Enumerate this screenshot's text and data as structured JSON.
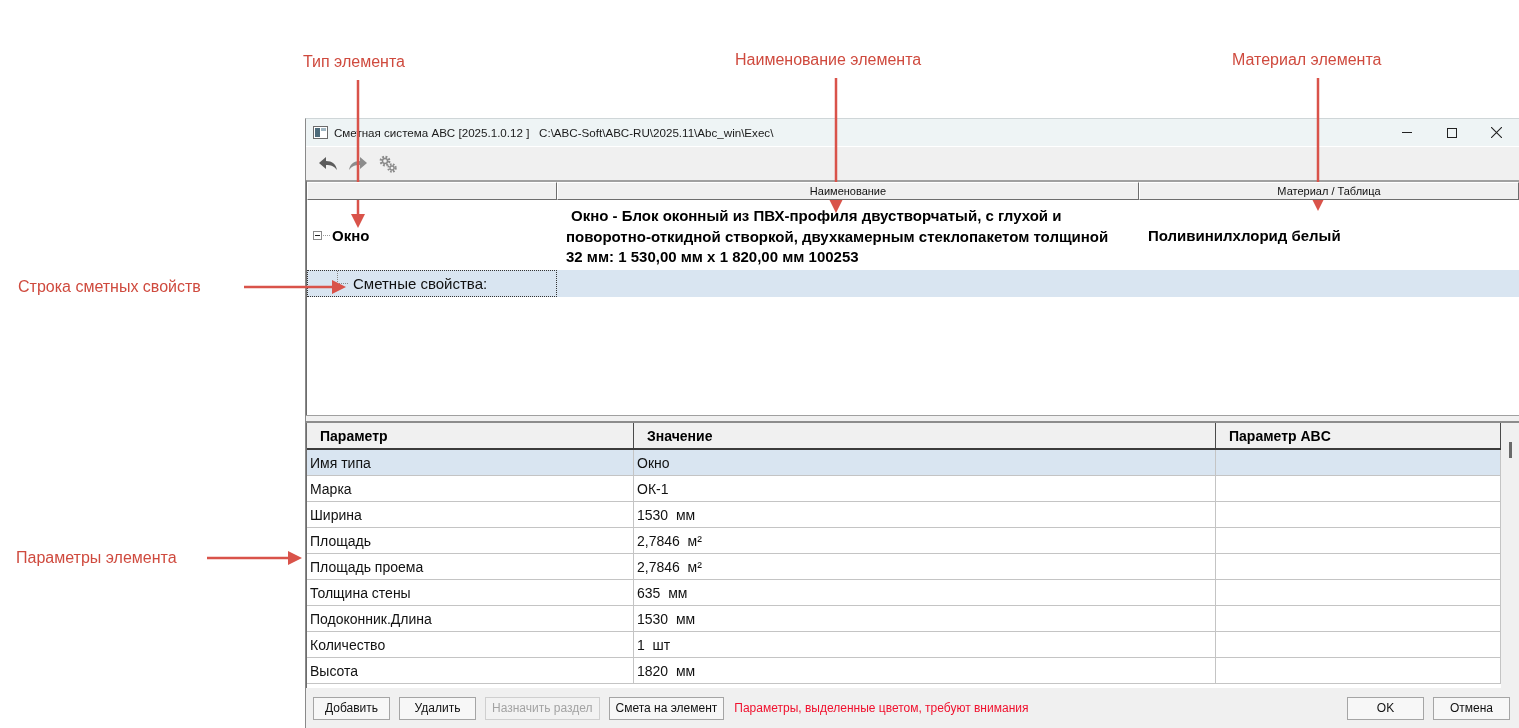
{
  "annotations": [
    {
      "label": "Тип элемента",
      "kind": "down"
    },
    {
      "label": "Наименование элемента",
      "kind": "down"
    },
    {
      "label": "Материал элемента",
      "kind": "down"
    },
    {
      "label": "Строка сметных свойств",
      "kind": "right"
    },
    {
      "label": "Параметры элемента",
      "kind": "right"
    }
  ],
  "window": {
    "title": "Сметная система ABC [2025.1.0.12 ]   C:\\ABC-Soft\\ABC-RU\\2025.11\\Abc_win\\Exec\\"
  },
  "elements_table": {
    "columns": [
      "Наименование",
      "Материал / Таблица"
    ],
    "rows": [
      {
        "type": "Окно",
        "expanded": true,
        "name": "Окно - Блок оконный из ПВХ-профиля двустворчатый, с глухой и поворотно-откидной створкой, двухкамерным стеклопакетом толщиной 32 мм: 1 530,00 мм x 1 820,00 мм 100253",
        "material": "Поливинилхлорид белый",
        "children": [
          {
            "label": "Сметные свойства:",
            "selected": true
          }
        ]
      }
    ]
  },
  "parameters_table": {
    "columns": [
      "Параметр",
      "Значение",
      "Параметр ABC"
    ],
    "rows": [
      {
        "parameter": "Имя типа",
        "value": "Окно",
        "selected": true
      },
      {
        "parameter": "Марка",
        "value": "ОК-1",
        "selected": false
      },
      {
        "parameter": "Ширина",
        "value": "1530  мм",
        "selected": false
      },
      {
        "parameter": "Площадь",
        "value": "2,7846  м²",
        "selected": false
      },
      {
        "parameter": "Площадь проема",
        "value": "2,7846  м²",
        "selected": false
      },
      {
        "parameter": "Толщина стены",
        "value": "635  мм",
        "selected": false
      },
      {
        "parameter": "Подоконник.Длина",
        "value": "1530  мм",
        "selected": false
      },
      {
        "parameter": "Количество",
        "value": "1  шт",
        "selected": false
      },
      {
        "parameter": "Высота",
        "value": "1820  мм",
        "selected": false
      }
    ]
  },
  "buttons": [
    {
      "label": "Добавить",
      "disabled": false
    },
    {
      "label": "Удалить",
      "disabled": false
    },
    {
      "label": "Назначить раздел",
      "disabled": true
    },
    {
      "label": "Смета на элемент",
      "disabled": false
    }
  ],
  "notice": "Параметры, выделенные цветом, требуют внимания",
  "dialog_buttons": [
    {
      "label": "OK"
    },
    {
      "label": "Отмена"
    }
  ]
}
